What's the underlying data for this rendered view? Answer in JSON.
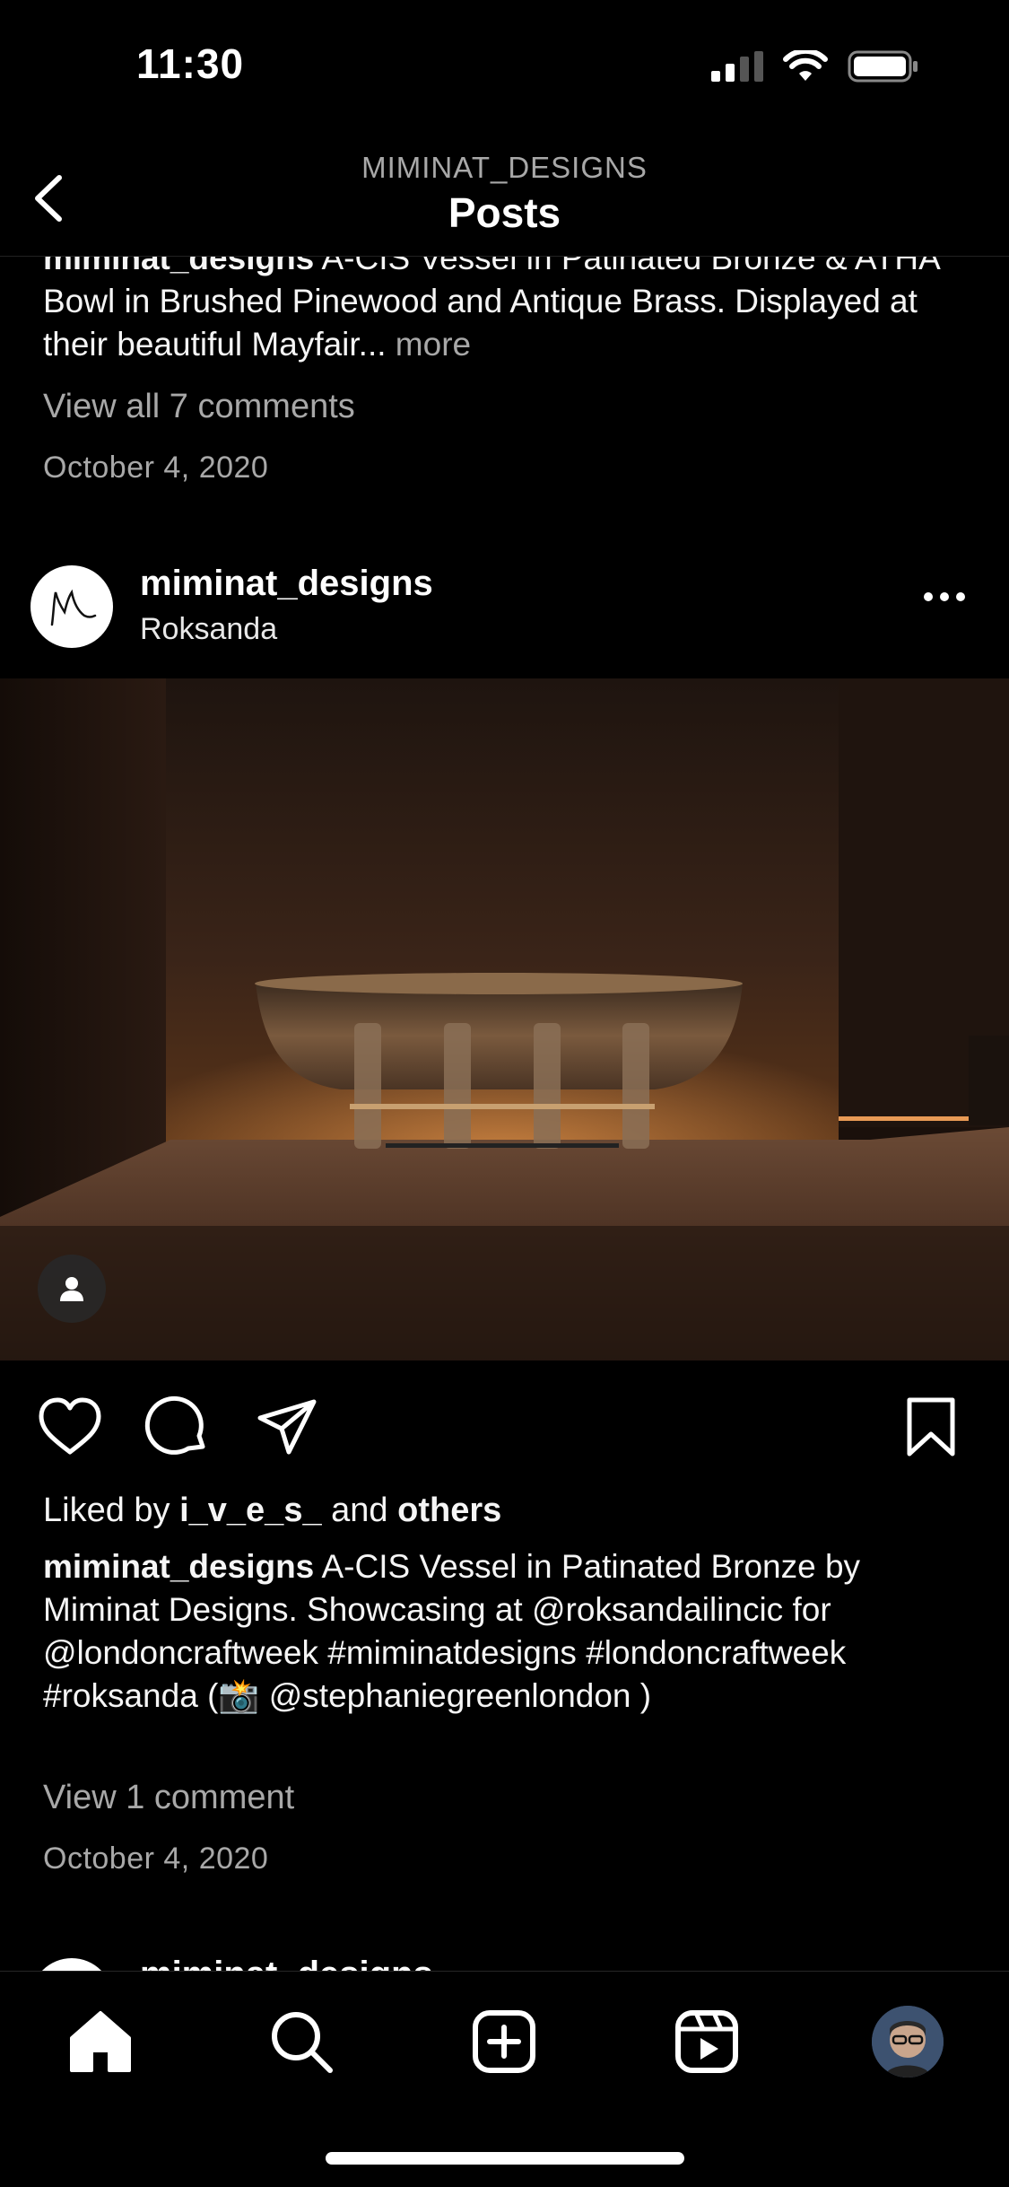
{
  "status_bar": {
    "time": "11:30"
  },
  "header": {
    "subtitle": "MIMINAT_DESIGNS",
    "title": "Posts"
  },
  "previous_post": {
    "caption_user": "miminat_designs",
    "caption_text": " A-CIS Vessel in Patinated Bronze & ATHA Bowl in Brushed Pinewood and Antique Brass. Displayed at their beautiful Mayfair...",
    "more_label": " more",
    "view_comments": "View all 7 comments",
    "date": "October 4, 2020"
  },
  "post": {
    "username": "miminat_designs",
    "location": "Roksanda",
    "likes_prefix": "Liked by ",
    "liked_by_user": "i_v_e_s_",
    "likes_and": " and ",
    "likes_others": "others",
    "caption_user": "miminat_designs",
    "caption_text": " A-CIS Vessel in Patinated Bronze by Miminat Designs. Showcasing at @roksandailincic for @londoncraftweek  #miminatdesigns #londoncraftweek #roksanda (📸 @stephaniegreenlondon )",
    "view_comments": "View 1 comment",
    "date": "October 4, 2020"
  },
  "next_post": {
    "username": "miminat_designs"
  },
  "tab_bar": {
    "items": [
      "home-icon",
      "search-icon",
      "create-icon",
      "reels-icon",
      "profile-avatar"
    ]
  },
  "colors": {
    "background": "#000000",
    "muted_text": "#a8a8a8"
  }
}
